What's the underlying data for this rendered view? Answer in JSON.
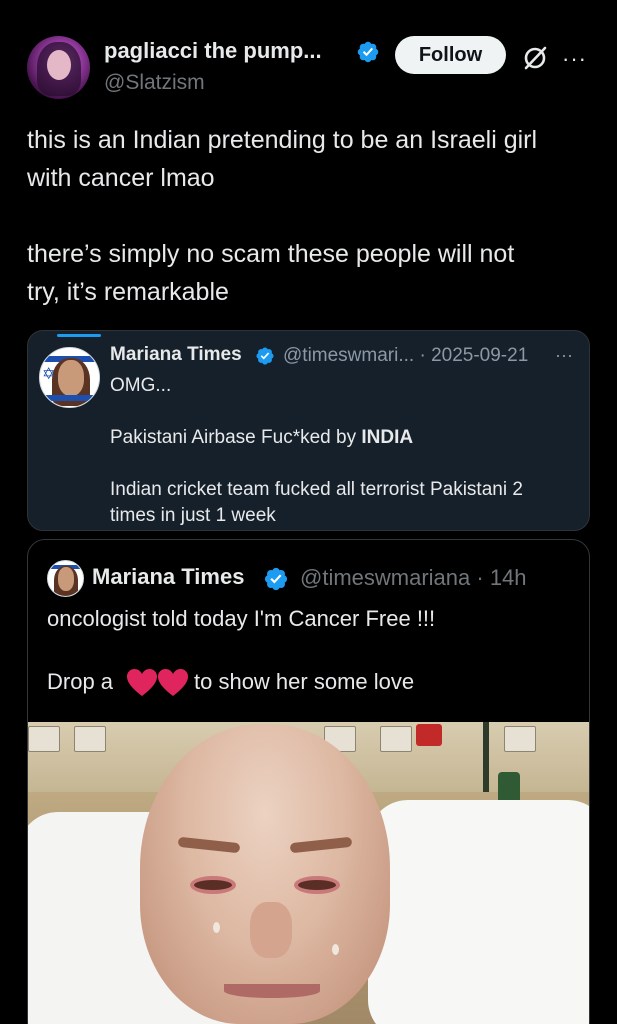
{
  "author": {
    "display_name": "pagliacci the pump...",
    "handle": "@Slatzism",
    "follow_label": "Follow",
    "more_icon": "more-icon",
    "grok_icon": "grok-icon"
  },
  "tweet": {
    "line1": "this is an Indian pretending to be an Israeli girl",
    "line2": "with cancer lmao",
    "line3": "there’s simply no scam these people will not",
    "line4": "try, it’s remarkable"
  },
  "quote": {
    "name": "Mariana Times",
    "handle_date": "@timeswmari... · 2025-09-21",
    "more": "···",
    "line1": "OMG...",
    "line2_prefix": "Pakistani Airbase Fuc*ked by ",
    "line2_bold": "INDIA",
    "line3": "Indian cricket team fucked all terrorist Pakistani 2",
    "line4": "times in just 1 week"
  },
  "nested_quote": {
    "name": "Mariana Times",
    "handle_time": "@timeswmariana · 14h",
    "line1": "oncologist told today I'm Cancer Free !!!",
    "line2_prefix": "Drop a",
    "line2_suffix": "to show her some love"
  },
  "colors": {
    "verified_blue": "#1d9bf0",
    "heart_red": "#e0245e"
  }
}
